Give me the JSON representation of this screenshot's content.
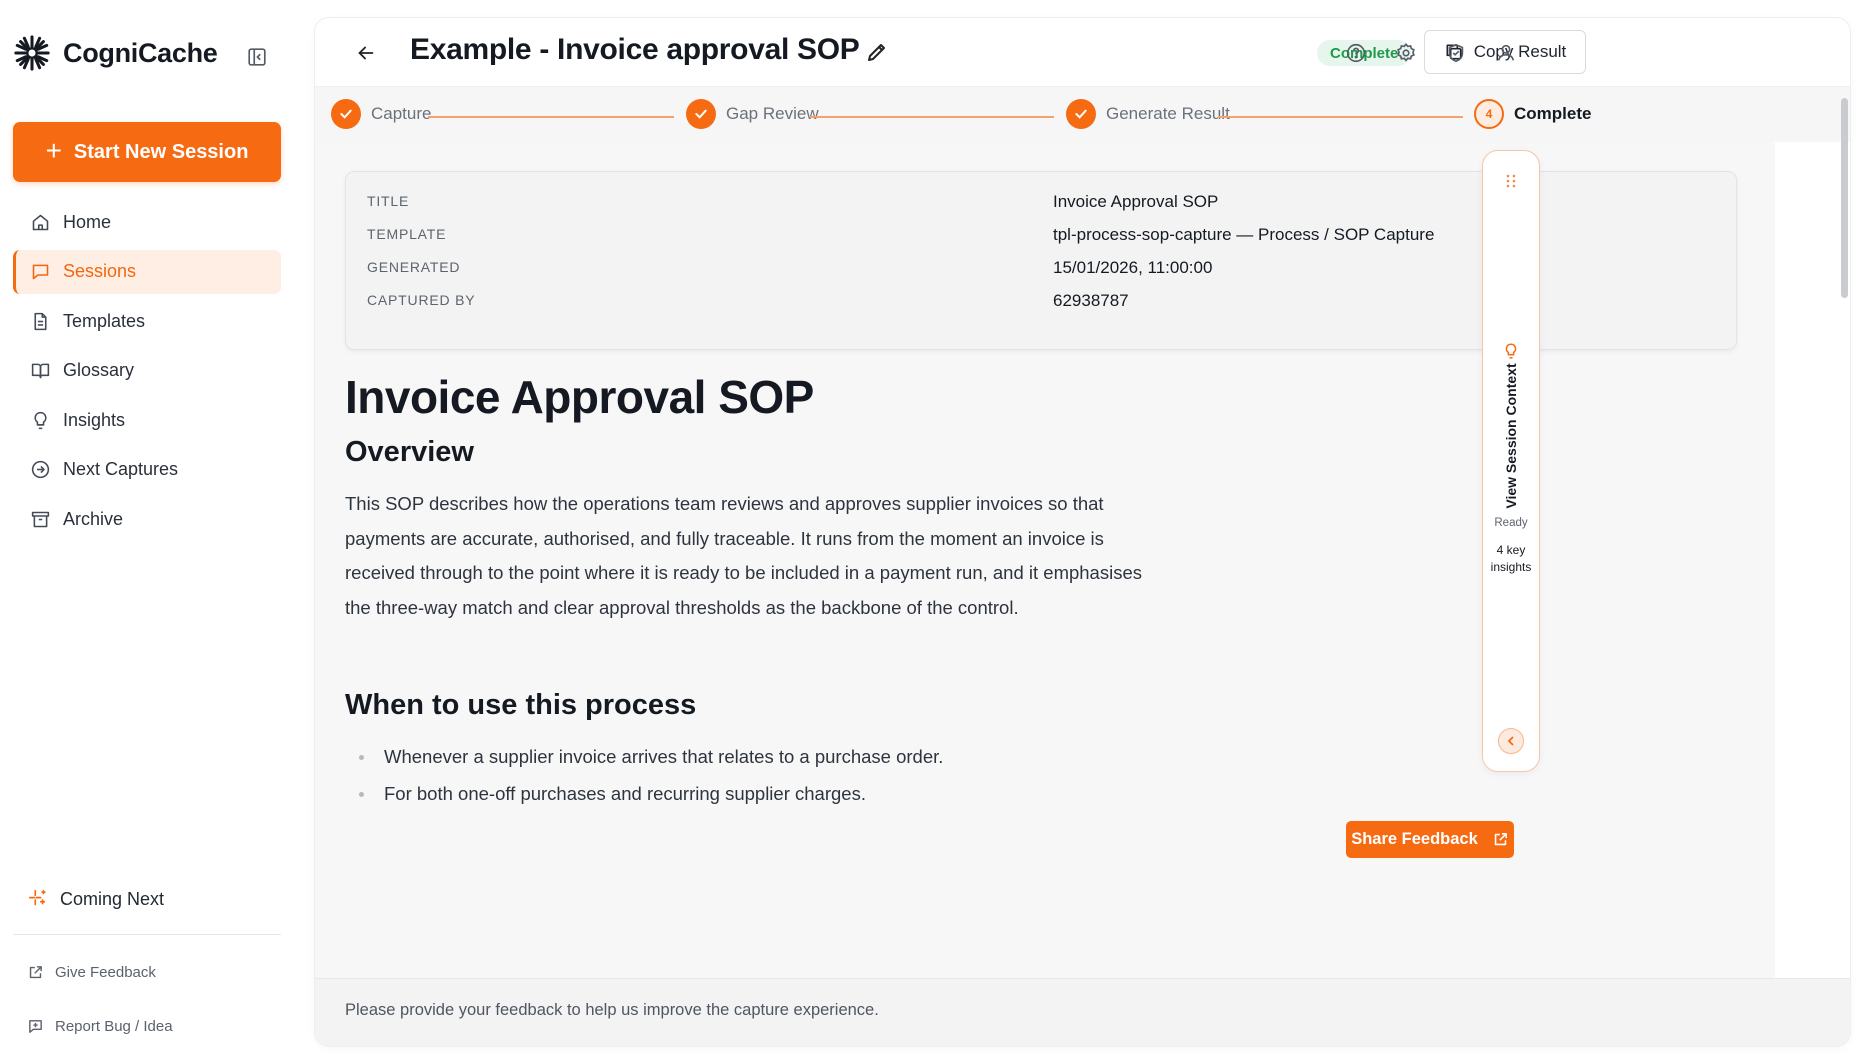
{
  "app": {
    "name": "CogniCache"
  },
  "sidebar": {
    "start_button": "Start New Session",
    "items": [
      {
        "label": "Home",
        "icon": "home-icon"
      },
      {
        "label": "Sessions",
        "icon": "chat-icon",
        "active": true
      },
      {
        "label": "Templates",
        "icon": "document-icon"
      },
      {
        "label": "Glossary",
        "icon": "book-icon"
      },
      {
        "label": "Insights",
        "icon": "lightbulb-icon"
      },
      {
        "label": "Next Captures",
        "icon": "arrow-circle-icon"
      },
      {
        "label": "Archive",
        "icon": "archive-icon"
      }
    ],
    "coming_next": "Coming Next",
    "give_feedback": "Give Feedback",
    "report_bug": "Report Bug / Idea"
  },
  "header": {
    "title": "Example - Invoice approval SOP",
    "status": "Complete",
    "copy_button": "Copy Result"
  },
  "stepper": {
    "steps": [
      {
        "label": "Capture",
        "state": "done"
      },
      {
        "label": "Gap Review",
        "state": "done"
      },
      {
        "label": "Generate Result",
        "state": "done"
      },
      {
        "label": "Complete",
        "state": "current",
        "number": "4"
      }
    ]
  },
  "meta": {
    "rows": [
      {
        "label": "Title",
        "value": "Invoice Approval SOP"
      },
      {
        "label": "Template",
        "value": "tpl-process-sop-capture — Process / SOP Capture"
      },
      {
        "label": "Generated",
        "value": "15/01/2026, 11:00:00"
      },
      {
        "label": "Captured by",
        "value": "62938787"
      }
    ]
  },
  "document": {
    "h1": "Invoice Approval SOP",
    "overview_heading": "Overview",
    "overview_text": "This SOP describes how the operations team reviews and approves supplier invoices so that payments are accurate, authorised, and fully traceable. It runs from the moment an invoice is received through to the point where it is ready to be included in a payment run, and it emphasises the three-way match and clear approval thresholds as the backbone of the control.",
    "when_heading": "When to use this process",
    "when_items": [
      "Whenever a supplier invoice arrives that relates to a purchase order.",
      "For both one-off purchases and recurring supplier charges."
    ]
  },
  "context_panel": {
    "label": "View Session Context",
    "status": "Ready",
    "insights": "4 key insights"
  },
  "footer": {
    "text": "Please provide your feedback to help us improve the capture experience.",
    "share_button": "Share Feedback"
  },
  "colors": {
    "accent": "#f66a12",
    "accent_soft": "#feeee3",
    "status_green": "#1f9a4c",
    "status_green_bg": "#e6f6ec"
  }
}
